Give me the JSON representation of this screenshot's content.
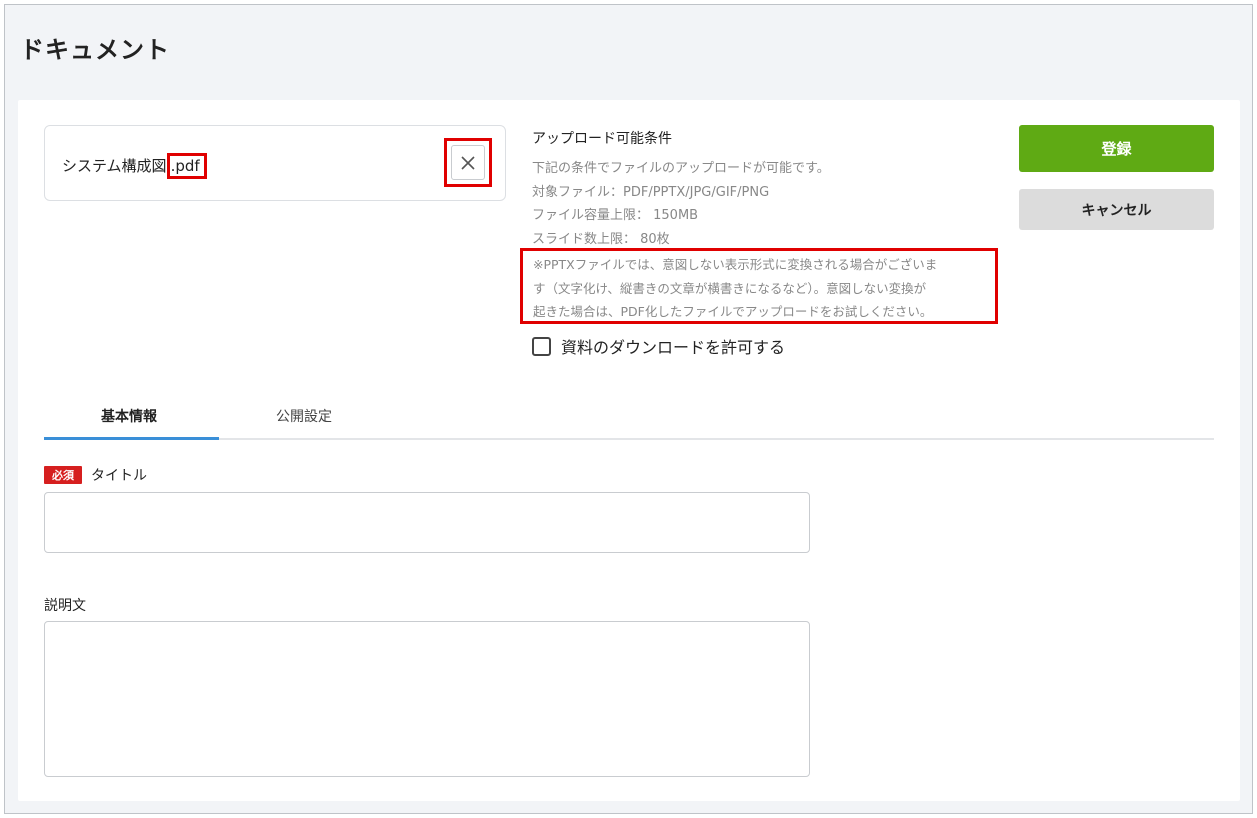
{
  "header": {
    "title": "ドキュメント"
  },
  "upload": {
    "file_name_base": "システム構成図",
    "file_name_ext": ".pdf",
    "remove_icon": "close-icon"
  },
  "conditions": {
    "title": "アップロード可能条件",
    "lines": [
      "下記の条件でファイルのアップロードが可能です。",
      "対象ファイル：PDF/PPTX/JPG/GIF/PNG",
      "ファイル容量上限： 150MB",
      "スライド数上限： 80枚"
    ],
    "note_lines": [
      "※PPTXファイルでは、意図しない表示形式に変換される場合がございま",
      "す（文字化け、縦書きの文章が横書きになるなど）。意図しない変換が",
      "起きた場合は、PDF化したファイルでアップロードをお試しください。"
    ]
  },
  "download_permission": {
    "label": "資料のダウンロードを許可する",
    "checked": false
  },
  "actions": {
    "register_label": "登録",
    "cancel_label": "キャンセル"
  },
  "tabs": [
    {
      "label": "基本情報",
      "active": true
    },
    {
      "label": "公開設定",
      "active": false
    }
  ],
  "form": {
    "required_badge": "必須",
    "title_label": "タイトル",
    "title_value": "",
    "description_label": "説明文",
    "description_value": ""
  },
  "colors": {
    "accent_green": "#5faa14",
    "tab_active": "#3a8fd8",
    "required_red": "#d61f1f",
    "highlight_red": "#e00000"
  }
}
